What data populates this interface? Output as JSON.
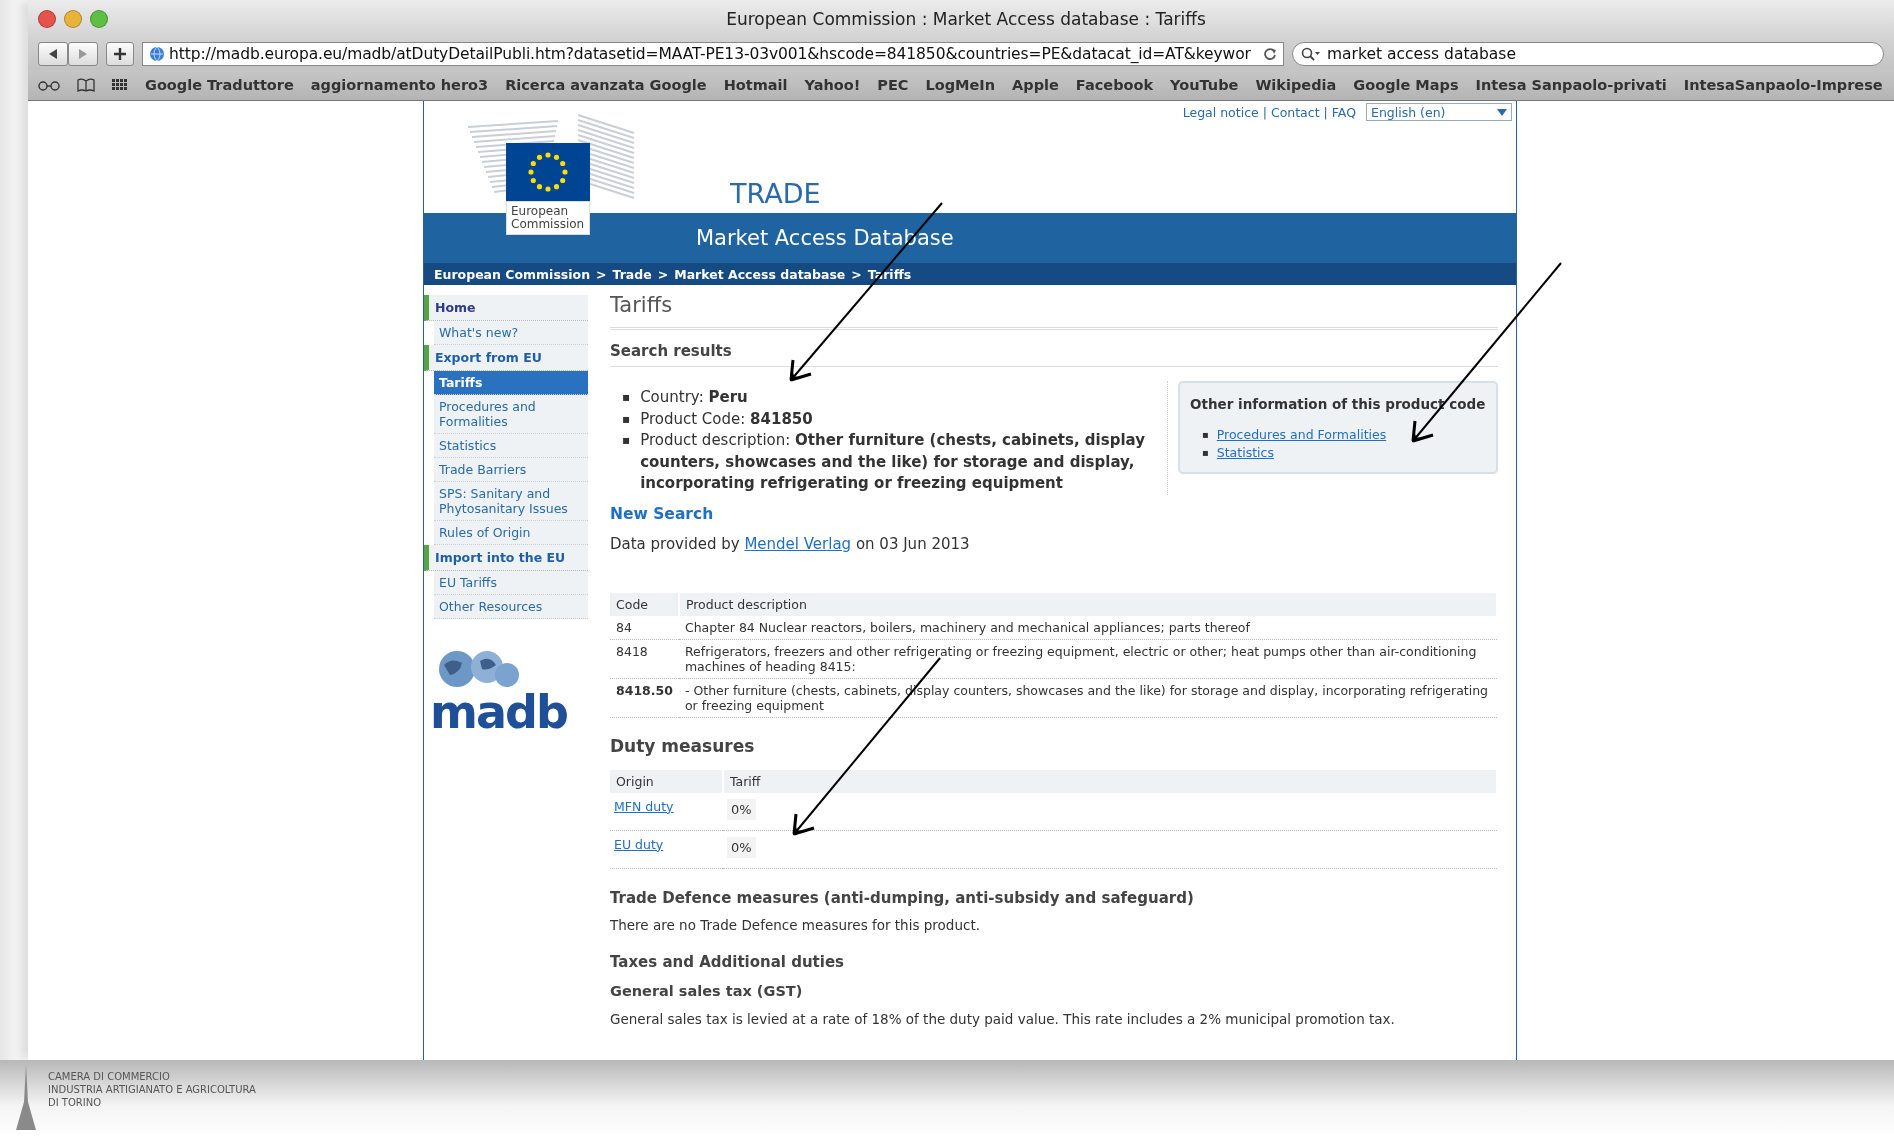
{
  "browser": {
    "title": "European Commission : Market Access database : Tariffs",
    "url": "http://madb.europa.eu/madb/atDutyDetailPubli.htm?datasetid=MAAT-PE13-03v001&hscode=841850&countries=PE&datacat_id=AT&keywor",
    "search": "market access database",
    "bookmarks": [
      "Google Traduttore",
      "aggiornamento hero3",
      "Ricerca avanzata Google",
      "Hotmail",
      "Yahoo!",
      "PEC",
      "LogMeIn",
      "Apple",
      "Facebook",
      "YouTube",
      "Wikipedia",
      "Google Maps",
      "Intesa Sanpaolo-privati",
      "IntesaSanpaolo-Imprese"
    ]
  },
  "site": {
    "top_links": [
      "Legal notice",
      "Contact",
      "FAQ"
    ],
    "link_separator": "|",
    "breadcrumb_separator": ">",
    "language": "English (en)",
    "logo_caption": "European Commission",
    "title": "TRADE",
    "subtitle": "Market Access Database",
    "breadcrumb": [
      "European Commission",
      "Trade",
      "Market Access database",
      "Tariffs"
    ],
    "sidebar": [
      {
        "kind": "section",
        "label": "Home",
        "selected": false
      },
      {
        "kind": "item",
        "label": "What's new?",
        "selected": false
      },
      {
        "kind": "section",
        "label": "Export from EU",
        "selected": false
      },
      {
        "kind": "item",
        "label": "Tariffs",
        "selected": true
      },
      {
        "kind": "item",
        "label": "Procedures and Formalities",
        "selected": false
      },
      {
        "kind": "item",
        "label": "Statistics",
        "selected": false
      },
      {
        "kind": "item",
        "label": "Trade Barriers",
        "selected": false
      },
      {
        "kind": "item",
        "label": "SPS: Sanitary and Phytosanitary Issues",
        "selected": false
      },
      {
        "kind": "item",
        "label": "Rules of Origin",
        "selected": false
      },
      {
        "kind": "section",
        "label": "Import into the EU",
        "selected": false
      },
      {
        "kind": "item",
        "label": "EU Tariffs",
        "selected": false
      },
      {
        "kind": "item",
        "label": "Other Resources",
        "selected": false
      }
    ],
    "madb_logo": "madb"
  },
  "main": {
    "title": "Tariffs",
    "results_heading": "Search results",
    "bullet": "▪",
    "details": [
      "Country: **Peru**",
      "Product Code: **841850**",
      "Product description: **Other furniture (chests, cabinets, display counters, showcases and the like) for storage and display, incorporating refrigerating or freezing equipment**"
    ],
    "other_info": {
      "title": "Other information of this product code",
      "links": [
        "Procedures and Formalities",
        "Statistics"
      ]
    },
    "new_search": "New Search",
    "provided": {
      "before": "Data provided by",
      "link": "Mendel Verlag",
      "after": "on 03 Jun 2013"
    },
    "product_table": {
      "columns": [
        "Code",
        "Product description"
      ],
      "rows": [
        {
          "code": "84",
          "description": "Chapter 84 Nuclear reactors, boilers, machinery and mechanical appliances; parts thereof",
          "emphasis": false
        },
        {
          "code": "8418",
          "description": "Refrigerators, freezers and other refrigerating or freezing equipment, electric or other; heat pumps other than air-conditioning machines of heading 8415:",
          "emphasis": false
        },
        {
          "code": "8418.50",
          "description": "- Other furniture (chests, cabinets, display counters, showcases and the like) for storage and display, incorporating refrigerating or freezing equipment",
          "emphasis": true
        }
      ]
    },
    "duty_heading": "Duty measures",
    "duty_table": {
      "columns": [
        "Origin",
        "Tariff"
      ],
      "rows": [
        {
          "origin": "MFN duty",
          "tariff": "0%"
        },
        {
          "origin": "EU duty",
          "tariff": "0%"
        }
      ]
    },
    "sections": [
      {
        "kind": "heading",
        "text": "Trade Defence measures (anti-dumping, anti-subsidy and safeguard)"
      },
      {
        "kind": "text",
        "text": "There are no Trade Defence measures for this product."
      },
      {
        "kind": "heading",
        "text": "Taxes and Additional duties"
      },
      {
        "kind": "subheading",
        "text": "General sales tax (GST)"
      },
      {
        "kind": "text",
        "text": "General sales tax is levied at a rate of 18% of the duty paid value. This rate includes a 2% municipal promotion tax."
      }
    ]
  },
  "footer": {
    "lines": [
      "CAMERA DI COMMERCIO",
      "INDUSTRIA ARTIGIANATO E AGRICOLTURA",
      "DI TORINO"
    ]
  }
}
